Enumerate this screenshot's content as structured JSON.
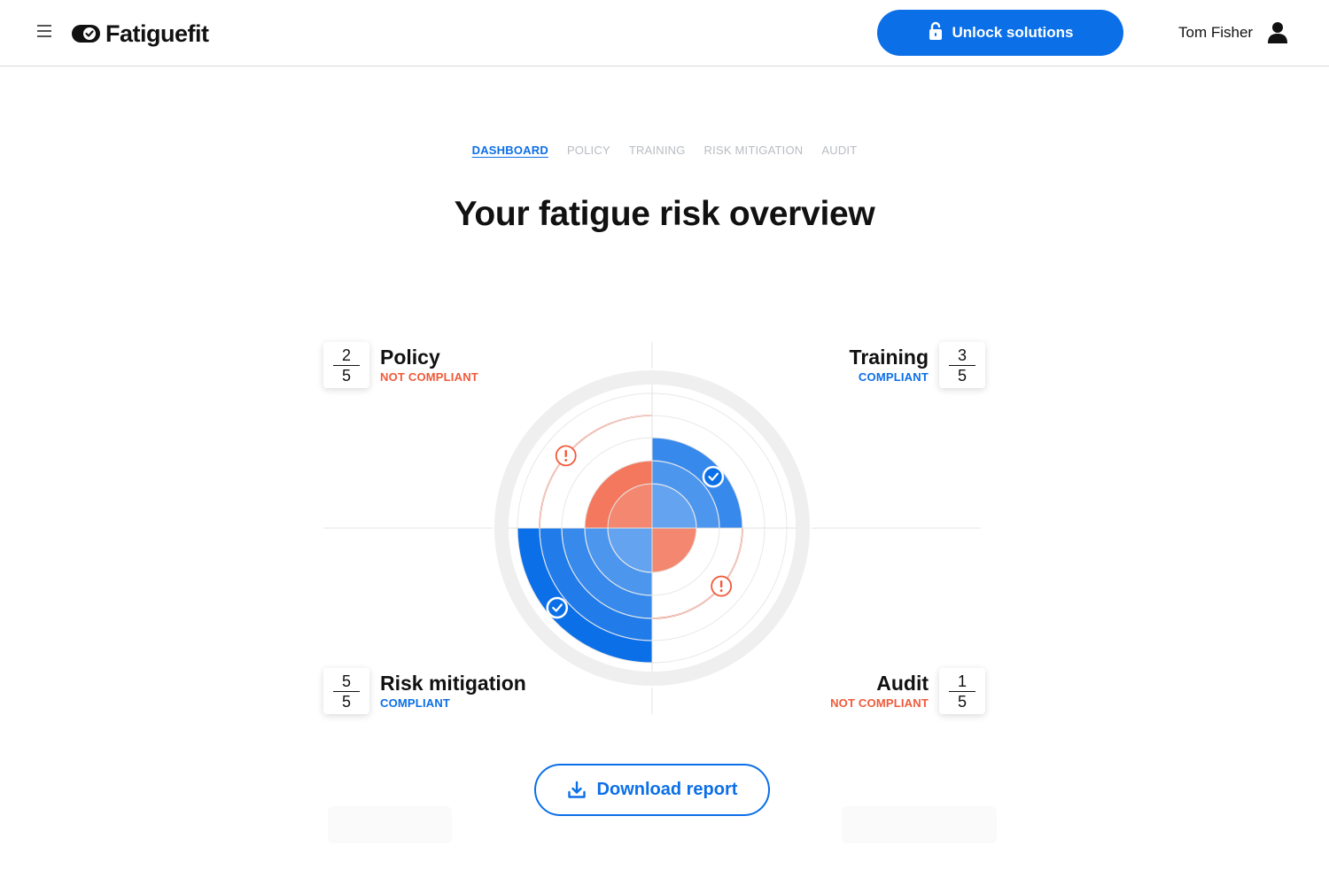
{
  "header": {
    "brand": "Fatiguefit",
    "unlock_label": "Unlock solutions",
    "user_name": "Tom Fisher"
  },
  "tabs": [
    {
      "label": "DASHBOARD",
      "active": true
    },
    {
      "label": "POLICY",
      "active": false
    },
    {
      "label": "TRAINING",
      "active": false
    },
    {
      "label": "RISK MITIGATION",
      "active": false
    },
    {
      "label": "AUDIT",
      "active": false
    }
  ],
  "title": "Your fatigue risk overview",
  "quadrants": {
    "policy": {
      "title": "Policy",
      "score": "2",
      "max": "5",
      "status": "NOT COMPLIANT"
    },
    "training": {
      "title": "Training",
      "score": "3",
      "max": "5",
      "status": "COMPLIANT"
    },
    "risk_mitigation": {
      "title": "Risk mitigation",
      "score": "5",
      "max": "5",
      "status": "COMPLIANT"
    },
    "audit": {
      "title": "Audit",
      "score": "1",
      "max": "5",
      "status": "NOT COMPLIANT"
    }
  },
  "chart_data": {
    "type": "radial-quadrant",
    "max_level": 5,
    "segments": [
      {
        "name": "Policy",
        "value": 2,
        "compliant": false
      },
      {
        "name": "Training",
        "value": 3,
        "compliant": true
      },
      {
        "name": "Risk mitigation",
        "value": 5,
        "compliant": true
      },
      {
        "name": "Audit",
        "value": 1,
        "compliant": false
      }
    ],
    "colors": {
      "compliant": "#0b6fe8",
      "not_compliant": "#f05a3a"
    }
  },
  "download_label": "Download report",
  "icons": {
    "menu": "hamburger-icon",
    "unlock": "unlock-icon",
    "user": "user-icon",
    "download": "download-icon",
    "check": "check-icon",
    "alert": "alert-icon"
  }
}
